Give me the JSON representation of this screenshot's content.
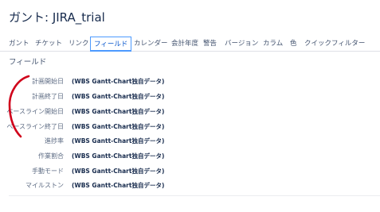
{
  "page": {
    "title": "ガント: JIRA_trial"
  },
  "tabs": [
    {
      "label": "ガント"
    },
    {
      "label": "チケット"
    },
    {
      "label": "リンク"
    },
    {
      "label": "フィールド",
      "active": true
    },
    {
      "label": "カレンダー"
    },
    {
      "label": "会計年度"
    },
    {
      "label": "警告"
    },
    {
      "label": "バージョン"
    },
    {
      "label": "カラム"
    },
    {
      "label": "色"
    },
    {
      "label": "クイックフィルター"
    }
  ],
  "section": {
    "heading": "フィールド"
  },
  "fields": [
    {
      "label": "計画開始日",
      "value": "(WBS Gantt-Chart独自データ)"
    },
    {
      "label": "計画終了日",
      "value": "(WBS Gantt-Chart独自データ)"
    },
    {
      "label": "ベースライン開始日",
      "value": "(WBS Gantt-Chart独自データ)"
    },
    {
      "label": "ベースライン終了日",
      "value": "(WBS Gantt-Chart独自データ)"
    },
    {
      "label": "進捗率",
      "value": "(WBS Gantt-Chart独自データ)"
    },
    {
      "label": "作業割合",
      "value": "(WBS Gantt-Chart独自データ)"
    },
    {
      "label": "手動モード",
      "value": "(WBS Gantt-Chart独自データ)"
    },
    {
      "label": "マイルストン",
      "value": "(WBS Gantt-Chart独自データ)"
    }
  ],
  "colors": {
    "accent": "#0052cc",
    "tab_border": "#4c9aff",
    "annotation": "#d0021b"
  }
}
